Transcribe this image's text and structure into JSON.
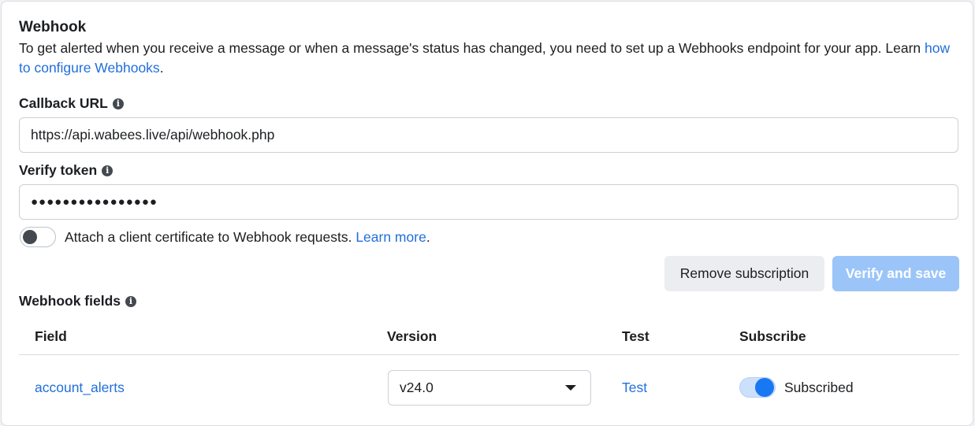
{
  "webhook": {
    "title": "Webhook",
    "description_prefix": "To get alerted when you receive a message or when a message's status has changed, you need to set up a Webhooks endpoint for your app. Learn ",
    "description_link": "how to configure Webhooks",
    "description_suffix": "."
  },
  "callback_url": {
    "label": "Callback URL",
    "value": "https://api.wabees.live/api/webhook.php"
  },
  "verify_token": {
    "label": "Verify token",
    "value": "●●●●●●●●●●●●●●●●"
  },
  "client_certificate": {
    "enabled": false,
    "text": "Attach a client certificate to Webhook requests. ",
    "link": "Learn more",
    "suffix": "."
  },
  "actions": {
    "remove_label": "Remove subscription",
    "verify_label": "Verify and save"
  },
  "webhook_fields": {
    "label": "Webhook fields",
    "columns": [
      "Field",
      "Version",
      "Test",
      "Subscribe"
    ],
    "rows": [
      {
        "field": "account_alerts",
        "version": "v24.0",
        "test": "Test",
        "subscribed": true,
        "subscribe_label": "Subscribed"
      }
    ]
  },
  "colors": {
    "link": "#216fdb",
    "primary_disabled": "#9bc5f9",
    "toggle_on": "#1877f2"
  },
  "icons": {
    "info": "info-icon",
    "dropdown": "chevron-down-icon"
  }
}
